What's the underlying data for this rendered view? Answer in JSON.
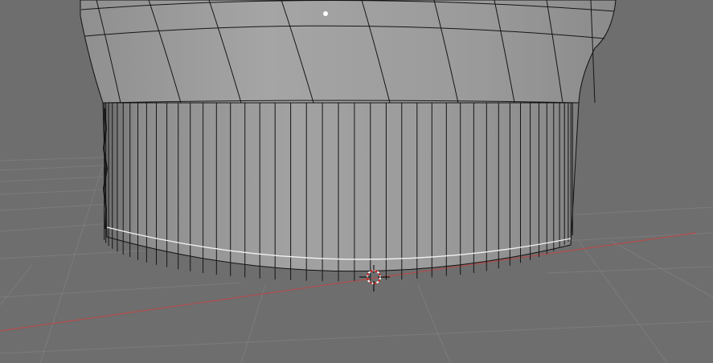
{
  "viewport": {
    "background_color": "#6e6e6e",
    "grid_color": "#777777",
    "x_axis_color": "#c05050",
    "mesh_face_color": "#9b9b9b",
    "mesh_edge_color": "#111111",
    "selected_edge_color": "#ffffff",
    "cursor_color": "#cc2222",
    "cursor_icon": "3d-cursor-icon"
  }
}
